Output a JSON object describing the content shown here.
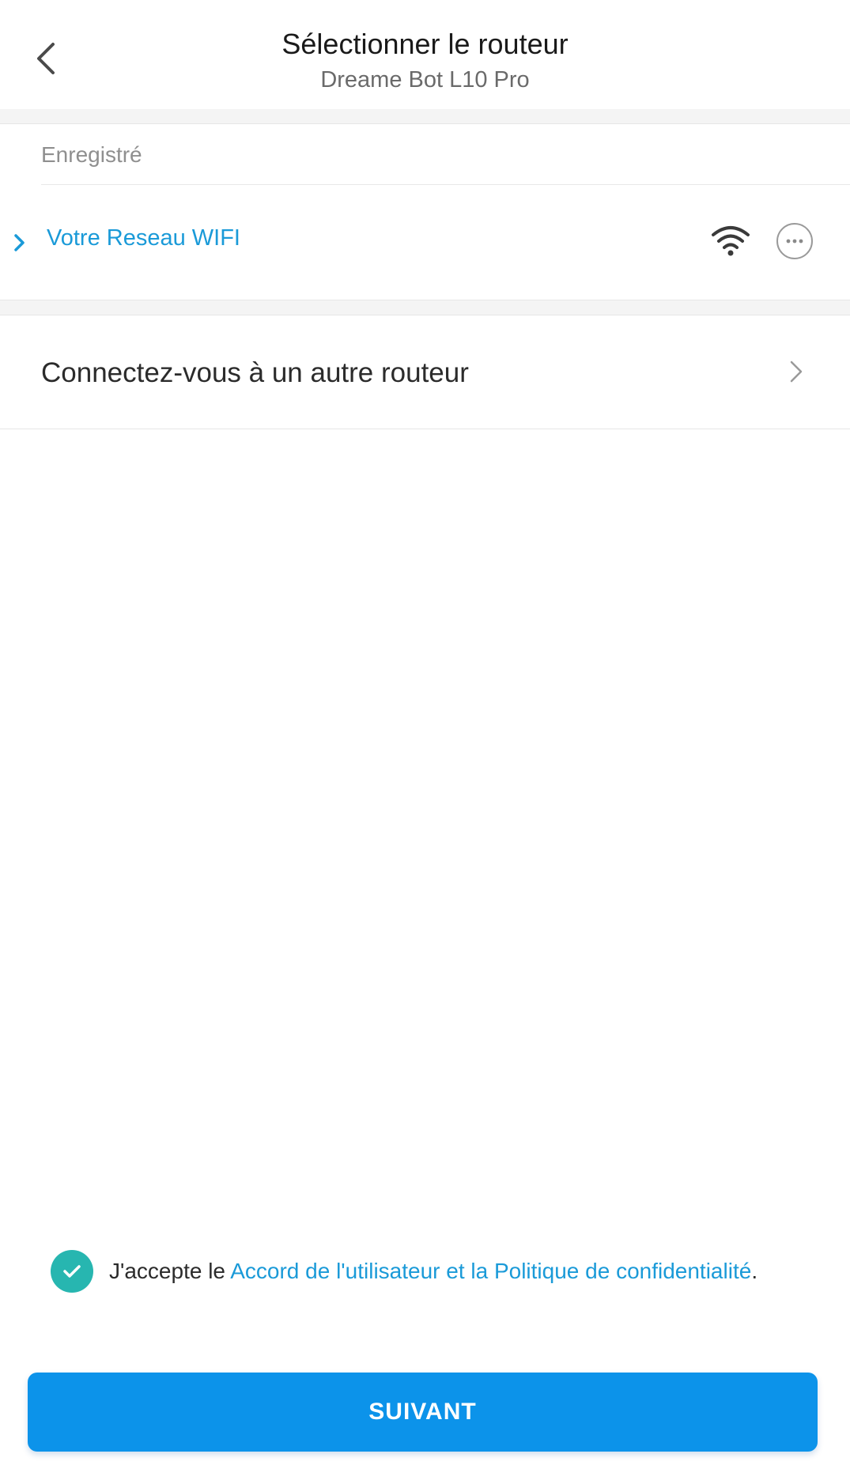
{
  "header": {
    "title": "Sélectionner le routeur",
    "subtitle": "Dreame Bot L10 Pro",
    "back_icon": "chevron-left-icon"
  },
  "saved": {
    "label": "Enregistré",
    "networks": [
      {
        "name": "Votre Reseau WIFI",
        "expand_icon": "chevron-right-icon",
        "signal_icon": "wifi-icon",
        "more_icon": "more-icon"
      }
    ]
  },
  "other_router": {
    "label": "Connectez-vous à un autre routeur",
    "icon": "chevron-right-icon"
  },
  "agreement": {
    "checked": true,
    "prefix": "J'accepte le ",
    "link": "Accord de l'utilisateur et la Politique de confidentialité",
    "suffix": "."
  },
  "next_button": {
    "label": "SUIVANT"
  },
  "colors": {
    "accent": "#1a9ad8",
    "button": "#0c93ea",
    "check": "#27b6b0",
    "separator": "#f4f4f4"
  }
}
